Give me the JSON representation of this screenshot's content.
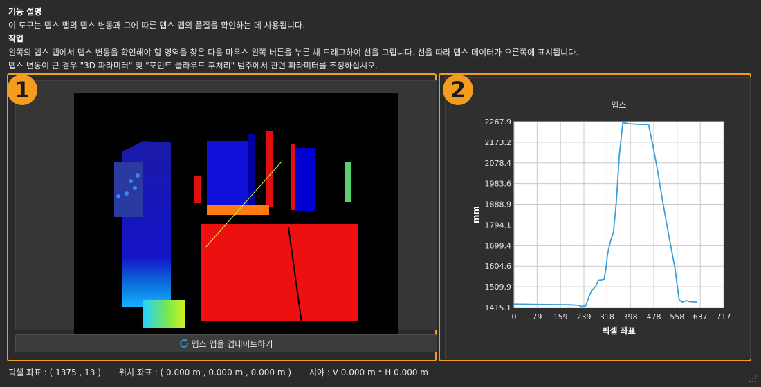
{
  "description": {
    "function_heading": "기능 설명",
    "function_text": "이 도구는 뎁스 맵의 뎁스 변동과 그에 따른 뎁스 맵의 품질을 확인하는 데 사용됩니다.",
    "task_heading": "작업",
    "task_line1": "왼쪽의 뎁스 맵에서 뎁스 변동을 확인해야 할 영역을 찾은 다음 마우스 왼쪽 버튼을 누른 채 드래그하여 선을 그립니다. 선을 따라 뎁스 데이터가 오른쪽에 표시됩니다.",
    "task_line2": "뎁스 변동이 큰 경우 \"3D 파라미터\" 및 \"포인트 클라우드 후처리\" 범주에서 관련 파라미터를 조정하십시오."
  },
  "badges": {
    "one": "1",
    "two": "2"
  },
  "update_button": {
    "label": "뎁스 맵을 업데이트하기",
    "icon": "refresh-icon"
  },
  "status_bar": {
    "pixel_coord": "픽셀 좌표 : ( 1375 , 13 )",
    "position_coord": "위치 좌표 : ( 0.000 m , 0.000 m , 0.000 m )",
    "fov": "시야 : V 0.000 m * H 0.000 m"
  },
  "colors": {
    "accent": "#f39c1e",
    "line": "#3a9fdc",
    "background": "#2b2b2b"
  },
  "chart_data": {
    "type": "line",
    "title": "뎁스",
    "xlabel": "픽셀 좌표",
    "ylabel": "mm",
    "xlim": [
      0,
      717
    ],
    "ylim": [
      1415.1,
      2267.9
    ],
    "xticks": [
      0,
      79,
      159,
      239,
      318,
      398,
      478,
      558,
      637,
      717
    ],
    "yticks": [
      1415.1,
      1509.9,
      1604.6,
      1699.4,
      1794.1,
      1888.9,
      1983.6,
      2078.4,
      2173.2,
      2267.9
    ],
    "grid": true,
    "series": [
      {
        "points": [
          [
            0,
            1430
          ],
          [
            60,
            1429
          ],
          [
            120,
            1428
          ],
          [
            190,
            1427
          ],
          [
            220,
            1425
          ],
          [
            230,
            1420
          ],
          [
            245,
            1422
          ],
          [
            255,
            1460
          ],
          [
            265,
            1492
          ],
          [
            280,
            1512
          ],
          [
            288,
            1540
          ],
          [
            300,
            1542
          ],
          [
            308,
            1545
          ],
          [
            315,
            1600
          ],
          [
            320,
            1660
          ],
          [
            325,
            1690
          ],
          [
            330,
            1720
          ],
          [
            340,
            1760
          ],
          [
            350,
            1900
          ],
          [
            360,
            2110
          ],
          [
            372,
            2262
          ],
          [
            380,
            2262
          ],
          [
            395,
            2258
          ],
          [
            430,
            2255
          ],
          [
            460,
            2255
          ],
          [
            475,
            2160
          ],
          [
            490,
            2050
          ],
          [
            510,
            1890
          ],
          [
            530,
            1740
          ],
          [
            550,
            1600
          ],
          [
            565,
            1450
          ],
          [
            575,
            1440
          ],
          [
            590,
            1447
          ],
          [
            600,
            1442
          ],
          [
            625,
            1440
          ]
        ]
      }
    ]
  }
}
